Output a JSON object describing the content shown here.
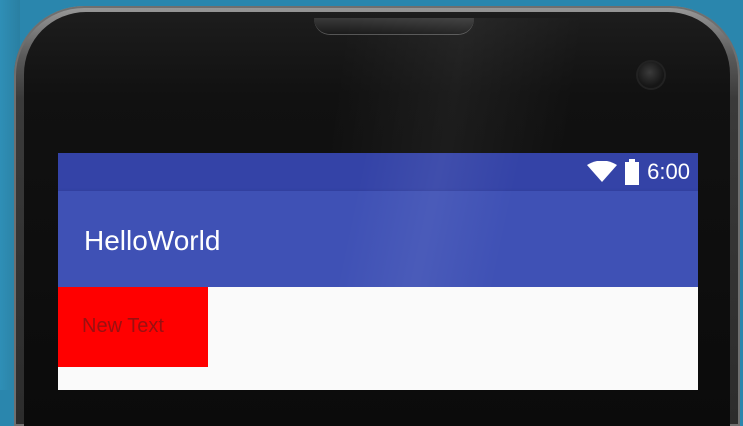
{
  "status_bar": {
    "time": "6:00",
    "wifi_icon": "wifi-icon",
    "battery_icon": "battery-icon",
    "background": "#3443a7"
  },
  "app_bar": {
    "title": "HelloWorld",
    "background": "#3f51b5"
  },
  "content": {
    "text_view": "New Text",
    "text_view_background": "#ff0000"
  }
}
